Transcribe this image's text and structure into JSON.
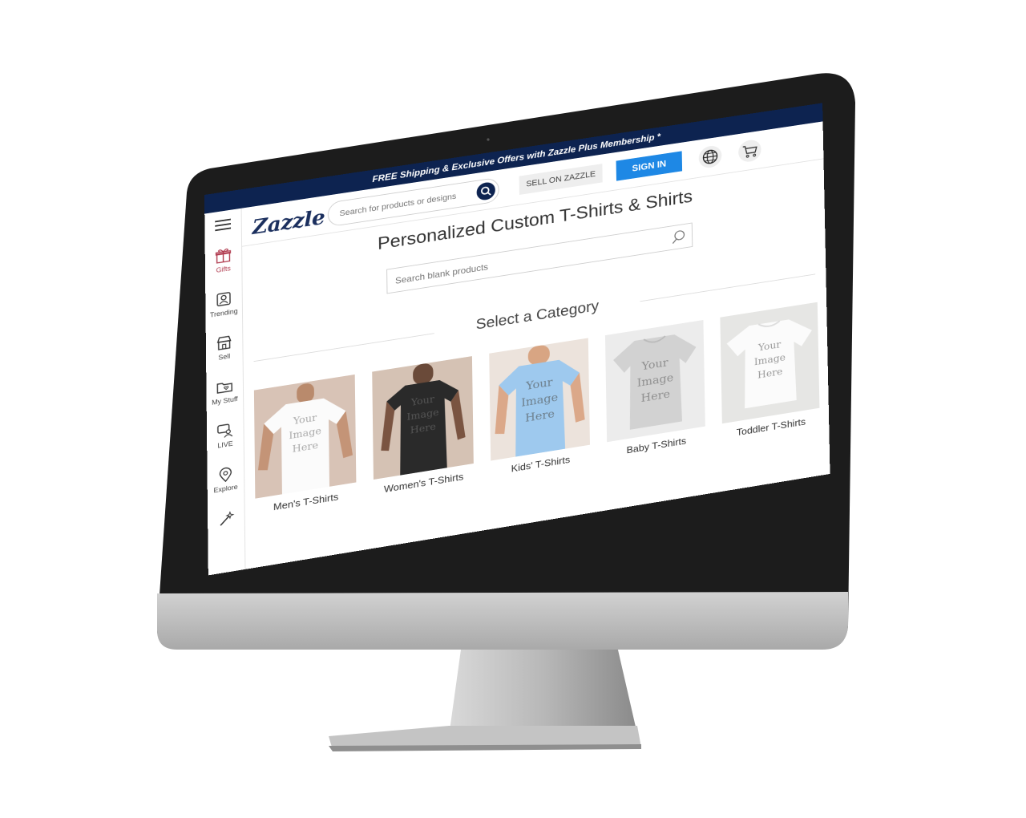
{
  "banner": {
    "text": "FREE Shipping & Exclusive Offers with Zazzle Plus Membership *"
  },
  "header": {
    "logo": "Zazzle",
    "search_placeholder": "Search for products or designs",
    "sell_label": "SELL ON ZAZZLE",
    "signin_label": "SIGN IN",
    "globe_icon": "globe-icon",
    "cart_icon": "cart-icon"
  },
  "sidebar": {
    "items": [
      {
        "label": "Gifts",
        "icon": "gift-icon"
      },
      {
        "label": "Trending",
        "icon": "trending-icon"
      },
      {
        "label": "Sell",
        "icon": "storefront-icon"
      },
      {
        "label": "My Stuff",
        "icon": "folder-heart-icon"
      },
      {
        "label": "LIVE",
        "icon": "chat-person-icon"
      },
      {
        "label": "Explore",
        "icon": "location-pin-icon"
      },
      {
        "label": "",
        "icon": "magic-wand-icon"
      }
    ]
  },
  "main": {
    "title": "Personalized Custom T-Shirts & Shirts",
    "blank_search_placeholder": "Search blank products",
    "category_heading": "Select a Category",
    "categories": [
      {
        "label": "Men's T-Shirts",
        "shirt_text": "Your Image Here"
      },
      {
        "label": "Women's T-Shirts",
        "shirt_text": "Your Image Here"
      },
      {
        "label": "Kids' T-Shirts",
        "shirt_text": "Your Image Here"
      },
      {
        "label": "Baby T-Shirts",
        "shirt_text": "Your Image Here"
      },
      {
        "label": "Toddler T-Shirts",
        "shirt_text": "Your Image Here"
      }
    ]
  },
  "colors": {
    "navy": "#0d2350",
    "accent": "#1e88e5",
    "gifts": "#b03a4e"
  }
}
